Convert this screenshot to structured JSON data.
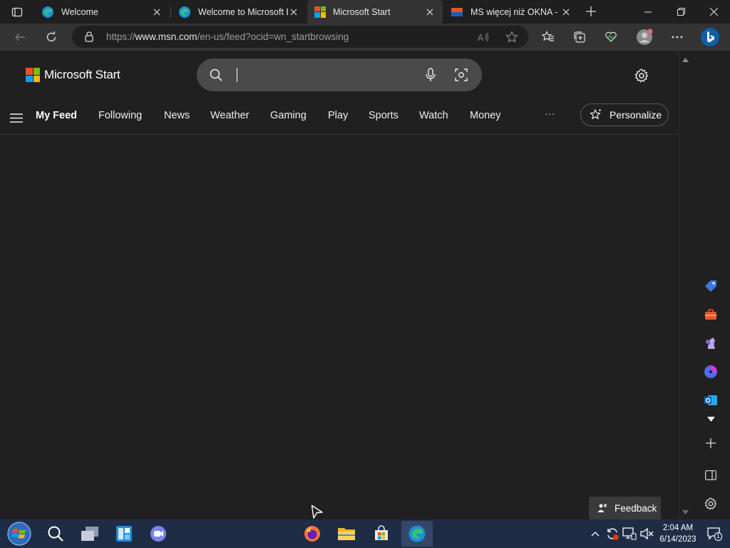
{
  "tabs": [
    {
      "title": "Welcome",
      "active": false
    },
    {
      "title": "Welcome to Microsoft E",
      "active": false
    },
    {
      "title": "Microsoft Start",
      "active": true
    },
    {
      "title": "MS więcej niż OKNA - p",
      "active": false
    }
  ],
  "address": {
    "url_prefix": "https://",
    "url_host": "www.msn.com",
    "url_path": "/en-us/feed?ocid=wn_startbrowsing"
  },
  "page": {
    "logo_text": "Microsoft Start",
    "nav": [
      "My Feed",
      "Following",
      "News",
      "Weather",
      "Gaming",
      "Play",
      "Sports",
      "Watch",
      "Money"
    ],
    "more_label": "···",
    "personalize_label": "Personalize",
    "feedback_label": "Feedback"
  },
  "taskbar": {
    "time": "2:04 AM",
    "date": "6/14/2023",
    "notification_count": "1"
  },
  "colors": {
    "background": "#202020",
    "taskbar": "#1e2c45",
    "accent_blue": "#0078d4"
  }
}
